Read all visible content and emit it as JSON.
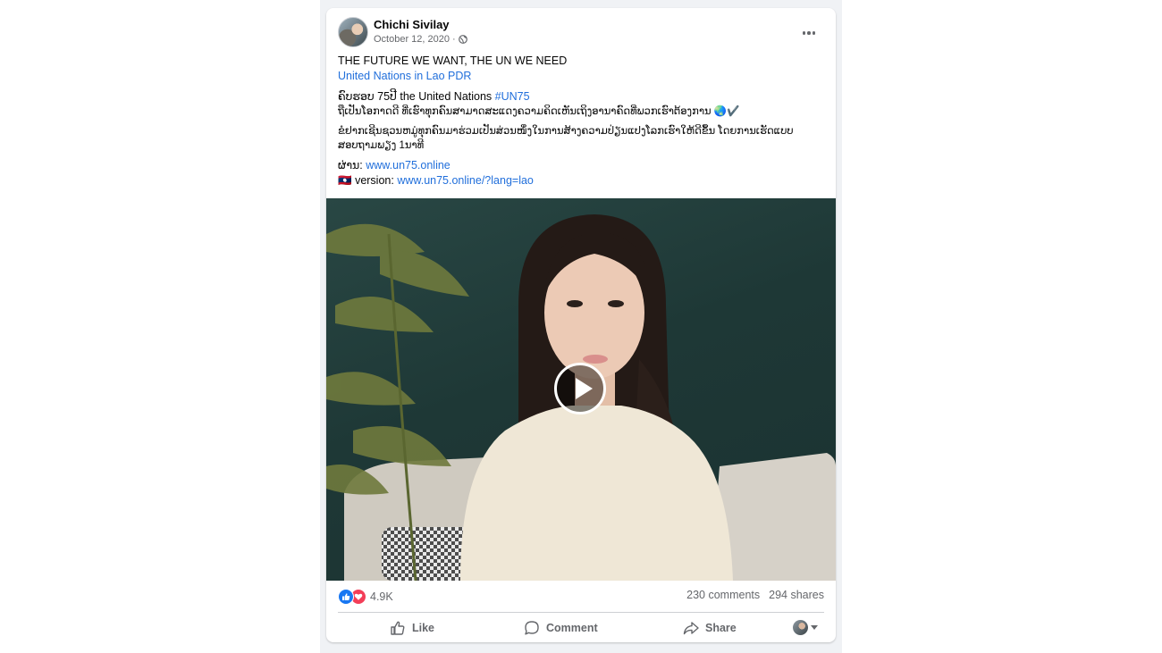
{
  "post": {
    "author": "Chichi Sivilay",
    "date": "October 12, 2020",
    "date_separator": "·",
    "privacy_icon": "globe-icon",
    "text": {
      "headline": "THE FUTURE WE WANT, THE UN WE NEED",
      "page_link": "United Nations in Lao PDR",
      "line3_prefix": "ຄົບຮອບ 75ປີ the United Nations",
      "line3_hashtag": "#UN75",
      "line4": "ຖືເປັນໂອກາດດີ ທີ່ເຮົາທຸກຄົນສາມາດສະແດງຄວາມຄິດເຫັນເຖິງອານາຄົດທີ່ພວກເຮົາຕ້ອງການ 🌏✔️",
      "line5": "ຂໍຢາກເຊີນຊວນຫມູ່ທຸກຄົນມາຮ່ວມເປັນສ່ວນໜຶ່ງໃນການສ້າງຄວາມປ່ຽນແປງໂລກເຮົາໃຫ້ດີຂຶ້ນ ໂດຍການເຮັດແບບສອບຖາມພຽງ 1ນາທີ",
      "source_label": "ຜ່ານ:",
      "source_link": "www.un75.online",
      "version_flag": "🇱🇦",
      "version_label": "version:",
      "version_link": "www.un75.online/?lang=lao"
    },
    "video": {
      "play_icon": "play-icon"
    },
    "stats": {
      "reaction_count": "4.9K",
      "comments": "230 comments",
      "shares": "294 shares"
    },
    "actions": {
      "like": "Like",
      "comment": "Comment",
      "share": "Share"
    }
  },
  "colors": {
    "link": "#216fdb",
    "like_blue": "#1877f2",
    "love_red": "#f33e58",
    "secondary_text": "#65676b"
  }
}
